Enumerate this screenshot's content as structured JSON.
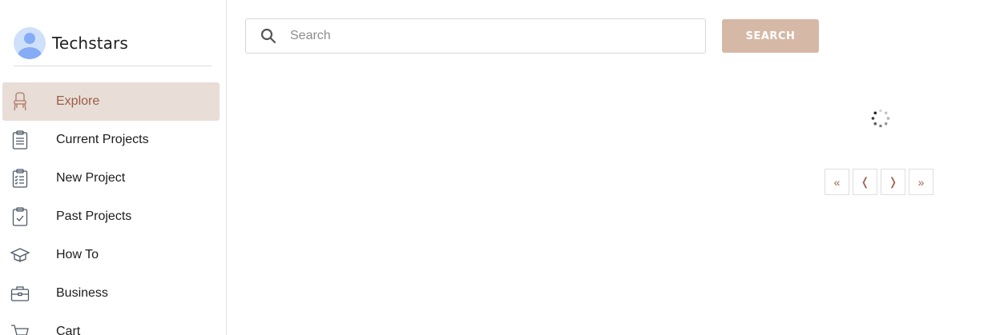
{
  "brand": {
    "name": "Techstars"
  },
  "sidebar": {
    "items": [
      {
        "label": "Explore",
        "icon": "chair-icon",
        "active": true
      },
      {
        "label": "Current Projects",
        "icon": "clipboard-list-icon"
      },
      {
        "label": "New Project",
        "icon": "clipboard-checklist-icon"
      },
      {
        "label": "Past Projects",
        "icon": "clipboard-check-icon"
      },
      {
        "label": "How To",
        "icon": "graduation-cap-icon"
      },
      {
        "label": "Business",
        "icon": "briefcase-icon"
      },
      {
        "label": "Cart",
        "icon": "cart-icon"
      }
    ]
  },
  "search": {
    "placeholder": "Search",
    "value": "",
    "button_label": "SEARCH"
  },
  "pagination": {
    "first": "«",
    "prev": "❬",
    "next": "❭",
    "last": "»"
  },
  "colors": {
    "accent": "#9a5d43",
    "active_bg": "#e8ddd7",
    "button_bg": "#d6b8a6"
  }
}
